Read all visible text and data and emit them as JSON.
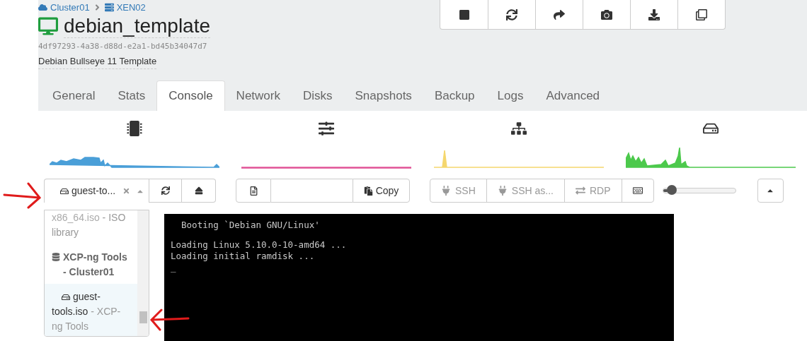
{
  "breadcrumb": [
    {
      "kind": "cloud",
      "label": "Cluster01"
    },
    {
      "kind": "host",
      "label": "XEN02"
    }
  ],
  "vm": {
    "title": "debian_template",
    "uuid": "4df97293-4a38-d88d-e2a1-bd45b34047d7",
    "description": "Debian Bullseye 11 Template"
  },
  "actions": [
    {
      "kind": "stop"
    },
    {
      "kind": "restart"
    },
    {
      "kind": "migrate"
    },
    {
      "kind": "snapshot"
    },
    {
      "kind": "export"
    },
    {
      "kind": "copy"
    }
  ],
  "tabs": [
    {
      "label": "General",
      "selected": false
    },
    {
      "label": "Stats",
      "selected": false
    },
    {
      "label": "Console",
      "selected": true
    },
    {
      "label": "Network",
      "selected": false
    },
    {
      "label": "Disks",
      "selected": false
    },
    {
      "label": "Snapshots",
      "selected": false
    },
    {
      "label": "Backup",
      "selected": false
    },
    {
      "label": "Logs",
      "selected": false
    },
    {
      "label": "Advanced",
      "selected": false
    }
  ],
  "sparklines": [
    {
      "kind": "cpu",
      "color": "#4a9fd8"
    },
    {
      "kind": "memory",
      "color": "#e05296"
    },
    {
      "kind": "network",
      "color": "#f5d76e"
    },
    {
      "kind": "disk",
      "color": "#4cc94c"
    }
  ],
  "iso_select": {
    "value": "guest-to...",
    "options": [
      {
        "kind": "option",
        "name": "x86_64.iso",
        "detail": "- ISO library",
        "selected": false
      },
      {
        "kind": "group",
        "name": "XCP-ng Tools - Cluster01"
      },
      {
        "kind": "option",
        "name": "guest-tools.iso",
        "detail": "- XCP-ng Tools",
        "selected": true
      }
    ]
  },
  "clipboard": {
    "copy_label": "Copy"
  },
  "remote": [
    {
      "kind": "ssh",
      "label": "SSH",
      "disabled": true
    },
    {
      "kind": "ssh",
      "label": "SSH as...",
      "disabled": true
    },
    {
      "kind": "rdp",
      "label": "RDP",
      "disabled": true
    },
    {
      "kind": "keyboard",
      "disabled": false
    }
  ],
  "scale": {
    "level": 0.07
  },
  "console": {
    "blocks": [
      [
        "  Booting `Debian GNU/Linux'"
      ],
      [
        "Loading Linux 5.10.0-10-amd64 ...",
        "Loading initial ramdisk ...",
        "_"
      ]
    ]
  }
}
